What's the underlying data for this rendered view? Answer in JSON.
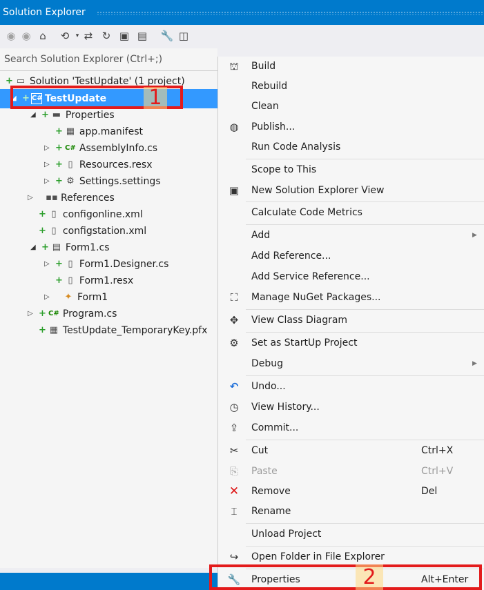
{
  "window": {
    "title": "Solution Explorer"
  },
  "toolbar": {
    "icons": [
      "back-icon",
      "forward-icon",
      "home-icon",
      "history-icon",
      "sync-icon",
      "refresh-icon",
      "collapse-all-icon",
      "show-all-files-icon",
      "properties-wrench-icon",
      "preview-icon"
    ]
  },
  "search": {
    "placeholder": "Search Solution Explorer (Ctrl+;)"
  },
  "tree": {
    "solution": "Solution 'TestUpdate' (1 project)",
    "project": "TestUpdate",
    "properties": "Properties",
    "app_manifest": "app.manifest",
    "assembly_info": "AssemblyInfo.cs",
    "resources": "Resources.resx",
    "settings": "Settings.settings",
    "references": "References",
    "configonline": "configonline.xml",
    "configstation": "configstation.xml",
    "form1": "Form1.cs",
    "form1_designer": "Form1.Designer.cs",
    "form1_resx": "Form1.resx",
    "form1_class": "Form1",
    "program": "Program.cs",
    "pfx": "TestUpdate_TemporaryKey.pfx"
  },
  "callouts": {
    "one": "1",
    "two": "2"
  },
  "menu": {
    "build": "Build",
    "rebuild": "Rebuild",
    "clean": "Clean",
    "publish": "Publish...",
    "run_code_analysis": "Run Code Analysis",
    "scope_to_this": "Scope to This",
    "new_view": "New Solution Explorer View",
    "calc_metrics": "Calculate Code Metrics",
    "add": "Add",
    "add_reference": "Add Reference...",
    "add_service_reference": "Add Service Reference...",
    "manage_nuget": "Manage NuGet Packages...",
    "view_class_diagram": "View Class Diagram",
    "set_startup": "Set as StartUp Project",
    "debug": "Debug",
    "undo": "Undo...",
    "view_history": "View History...",
    "commit": "Commit...",
    "cut": "Cut",
    "cut_shortcut": "Ctrl+X",
    "paste": "Paste",
    "paste_shortcut": "Ctrl+V",
    "remove": "Remove",
    "remove_shortcut": "Del",
    "rename": "Rename",
    "unload_project": "Unload Project",
    "open_folder": "Open Folder in File Explorer",
    "properties": "Properties",
    "properties_shortcut": "Alt+Enter"
  },
  "colors": {
    "accent": "#007acc",
    "selection": "#3399ff",
    "callout": "#e31b1b"
  }
}
